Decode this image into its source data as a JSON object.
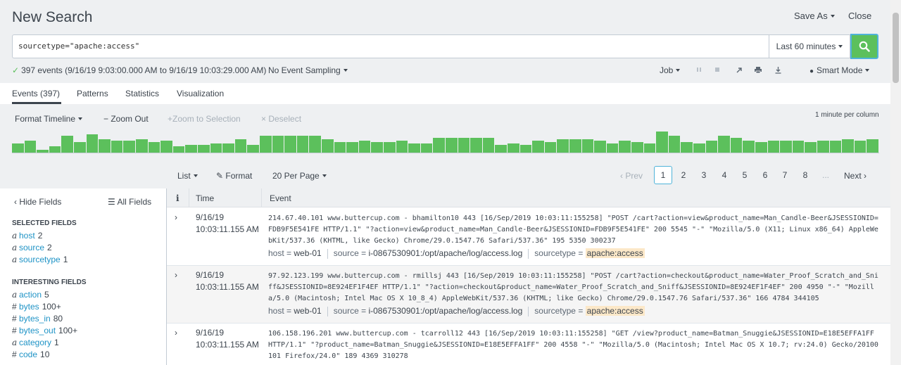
{
  "header": {
    "title": "New Search",
    "save_as": "Save As",
    "close": "Close"
  },
  "search": {
    "query": "sourcetype=\"apache:access\"",
    "time_range": "Last 60 minutes"
  },
  "status": {
    "events_text": "397 events (9/16/19 9:03:00.000 AM to 9/16/19 10:03:29.000 AM)",
    "sampling": "No Event Sampling",
    "job": "Job",
    "mode": "Smart Mode"
  },
  "tabs": [
    {
      "label": "Events (397)"
    },
    {
      "label": "Patterns"
    },
    {
      "label": "Statistics"
    },
    {
      "label": "Visualization"
    }
  ],
  "timeline": {
    "format": "Format Timeline",
    "zoom_out": "Zoom Out",
    "zoom_selection": "Zoom to Selection",
    "deselect": "Deselect",
    "scale": "1 minute per column",
    "bar_color": "#5cc05c",
    "counts": [
      6,
      8,
      2,
      4,
      11,
      7,
      12,
      9,
      8,
      8,
      9,
      7,
      8,
      4,
      5,
      5,
      6,
      6,
      9,
      5,
      11,
      11,
      11,
      11,
      11,
      9,
      7,
      7,
      8,
      7,
      7,
      8,
      6,
      6,
      10,
      10,
      10,
      10,
      10,
      5,
      6,
      5,
      8,
      7,
      9,
      9,
      9,
      8,
      6,
      8,
      7,
      6,
      14,
      11,
      7,
      6,
      8,
      11,
      10,
      8,
      7,
      8,
      8,
      8,
      7,
      8,
      8,
      9,
      8,
      9
    ]
  },
  "pager": {
    "list": "List",
    "format": "Format",
    "per_page": "20 Per Page",
    "prev": "Prev",
    "pages": [
      "1",
      "2",
      "3",
      "4",
      "5",
      "6",
      "7",
      "8"
    ],
    "ellipsis": "...",
    "next": "Next",
    "active_page": "1"
  },
  "sidebar": {
    "hide_fields": "Hide Fields",
    "all_fields": "All Fields",
    "selected_title": "SELECTED FIELDS",
    "selected": [
      {
        "type": "a",
        "name": "host",
        "count": "2"
      },
      {
        "type": "a",
        "name": "source",
        "count": "2"
      },
      {
        "type": "a",
        "name": "sourcetype",
        "count": "1"
      }
    ],
    "interesting_title": "INTERESTING FIELDS",
    "interesting": [
      {
        "type": "a",
        "name": "action",
        "count": "5"
      },
      {
        "type": "#",
        "name": "bytes",
        "count": "100+"
      },
      {
        "type": "#",
        "name": "bytes_in",
        "count": "80"
      },
      {
        "type": "#",
        "name": "bytes_out",
        "count": "100+"
      },
      {
        "type": "a",
        "name": "category",
        "count": "1"
      },
      {
        "type": "#",
        "name": "code",
        "count": "10"
      }
    ]
  },
  "table": {
    "col_info": "i",
    "col_time": "Time",
    "col_event": "Event",
    "rows": [
      {
        "date": "9/16/19",
        "time": "10:03:11.155 AM",
        "raw": "214.67.40.101 www.buttercup.com - bhamilton10 443 [16/Sep/2019 10:03:11:155258] \"POST /cart?action=view&product_name=Man_Candle-Beer&JSESSIONID=FDB9F5E541FE HTTP/1.1\" \"?action=view&product_name=Man_Candle-Beer&JSESSIONID=FDB9F5E541FE\" 200 5545 \"-\" \"Mozilla/5.0 (X11; Linux x86_64) AppleWebKit/537.36 (KHTML, like Gecko) Chrome/29.0.1547.76 Safari/537.36\" 195 5350 300237",
        "host_label": "host =",
        "host": "web-01",
        "source_label": "source =",
        "source": "i-0867530901:/opt/apache/log/access.log",
        "sourcetype_label": "sourcetype =",
        "sourcetype": "apache:access"
      },
      {
        "date": "9/16/19",
        "time": "10:03:11.155 AM",
        "raw": "97.92.123.199 www.buttercup.com - rmillsj 443 [16/Sep/2019 10:03:11:155258] \"POST /cart?action=checkout&product_name=Water_Proof_Scratch_and_Sniff&JSESSIONID=8E924EF1F4EF HTTP/1.1\" \"?action=checkout&product_name=Water_Proof_Scratch_and_Sniff&JSESSIONID=8E924EF1F4EF\" 200 4950 \"-\" \"Mozilla/5.0 (Macintosh; Intel Mac OS X 10_8_4) AppleWebKit/537.36 (KHTML; like Gecko) Chrome/29.0.1547.76 Safari/537.36\" 166 4784 344105",
        "host_label": "host =",
        "host": "web-01",
        "source_label": "source =",
        "source": "i-0867530901:/opt/apache/log/access.log",
        "sourcetype_label": "sourcetype =",
        "sourcetype": "apache:access"
      },
      {
        "date": "9/16/19",
        "time": "10:03:11.155 AM",
        "raw": "106.158.196.201 www.buttercup.com - tcarroll12 443 [16/Sep/2019 10:03:11:155258] \"GET /view?product_name=Batman_Snuggie&JSESSIONID=E18E5EFFA1FF HTTP/1.1\" \"?product_name=Batman_Snuggie&JSESSIONID=E18E5EFFA1FF\" 200 4558 \"-\" \"Mozilla/5.0 (Macintosh; Intel Mac OS X 10.7; rv:24.0) Gecko/20100101 Firefox/24.0\" 189 4369 310278"
      }
    ]
  }
}
